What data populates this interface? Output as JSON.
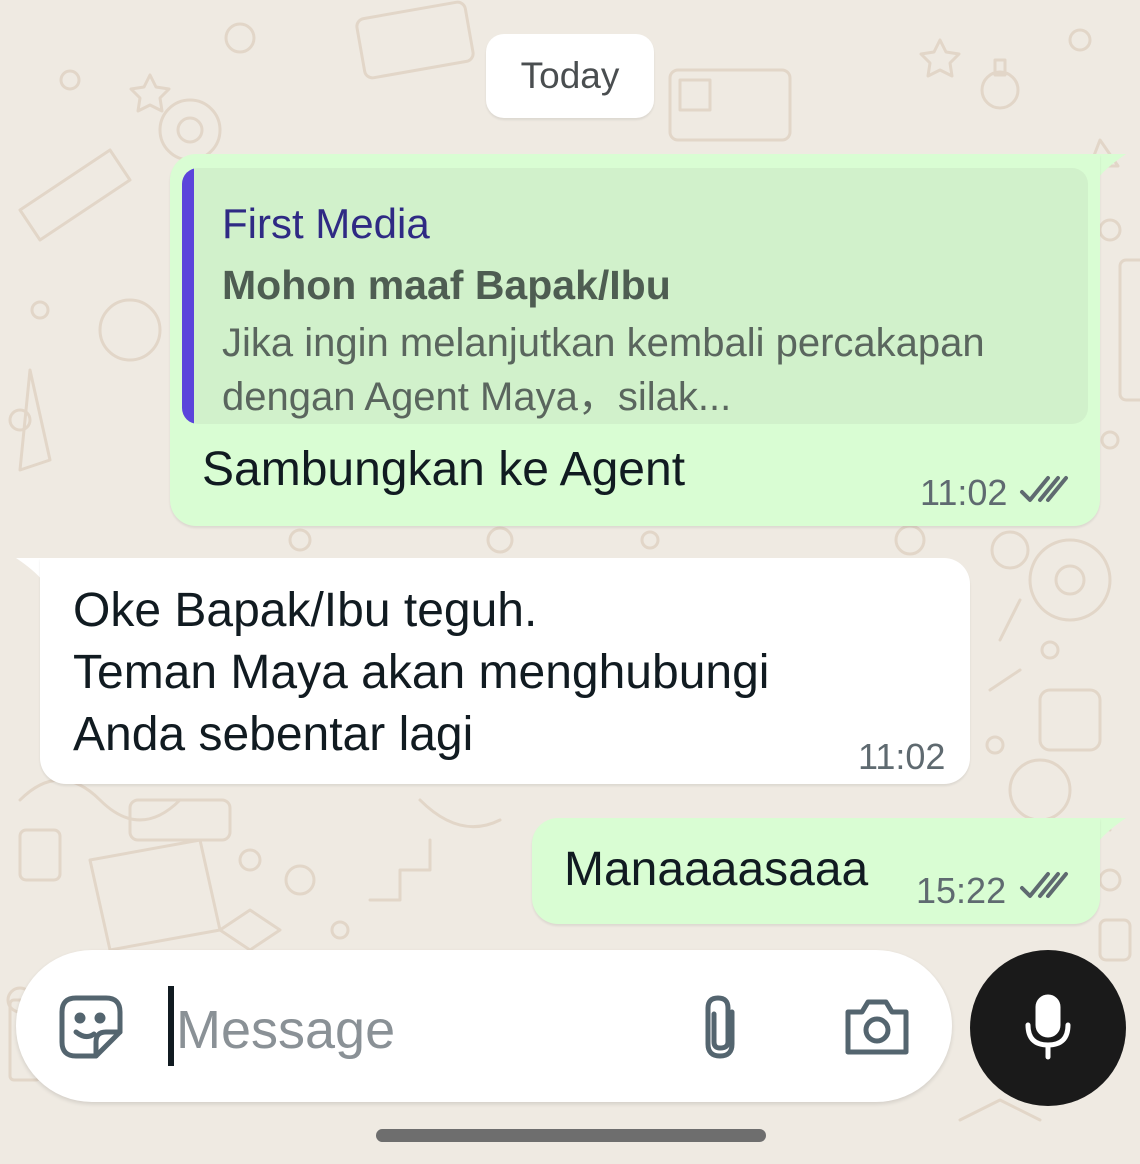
{
  "date_separator": "Today",
  "messages": [
    {
      "direction": "outgoing",
      "reply_to": {
        "author": "First Media",
        "title": "Mohon maaf Bapak/Ibu",
        "body": "Jika ingin melanjutkan kembali percakapan dengan Agent Maya，silak..."
      },
      "text": "Sambungkan ke Agent",
      "time": "11:02",
      "status": "read"
    },
    {
      "direction": "incoming",
      "text_lines": [
        "Oke Bapak/Ibu teguh.",
        "Teman Maya akan menghubungi",
        "Anda sebentar lagi"
      ],
      "time": "11:02"
    },
    {
      "direction": "outgoing",
      "text": "Manaaaasaaa",
      "time": "15:22",
      "status": "read"
    }
  ],
  "composer": {
    "placeholder": "Message",
    "icons": [
      "sticker-icon",
      "attach-icon",
      "camera-icon",
      "mic-icon"
    ]
  },
  "colors": {
    "outgoing_bubble": "#d9fdd3",
    "incoming_bubble": "#ffffff",
    "chat_background": "#efeae2",
    "quote_bar": "#5b44db",
    "mic_button": "#1a1a1a"
  }
}
